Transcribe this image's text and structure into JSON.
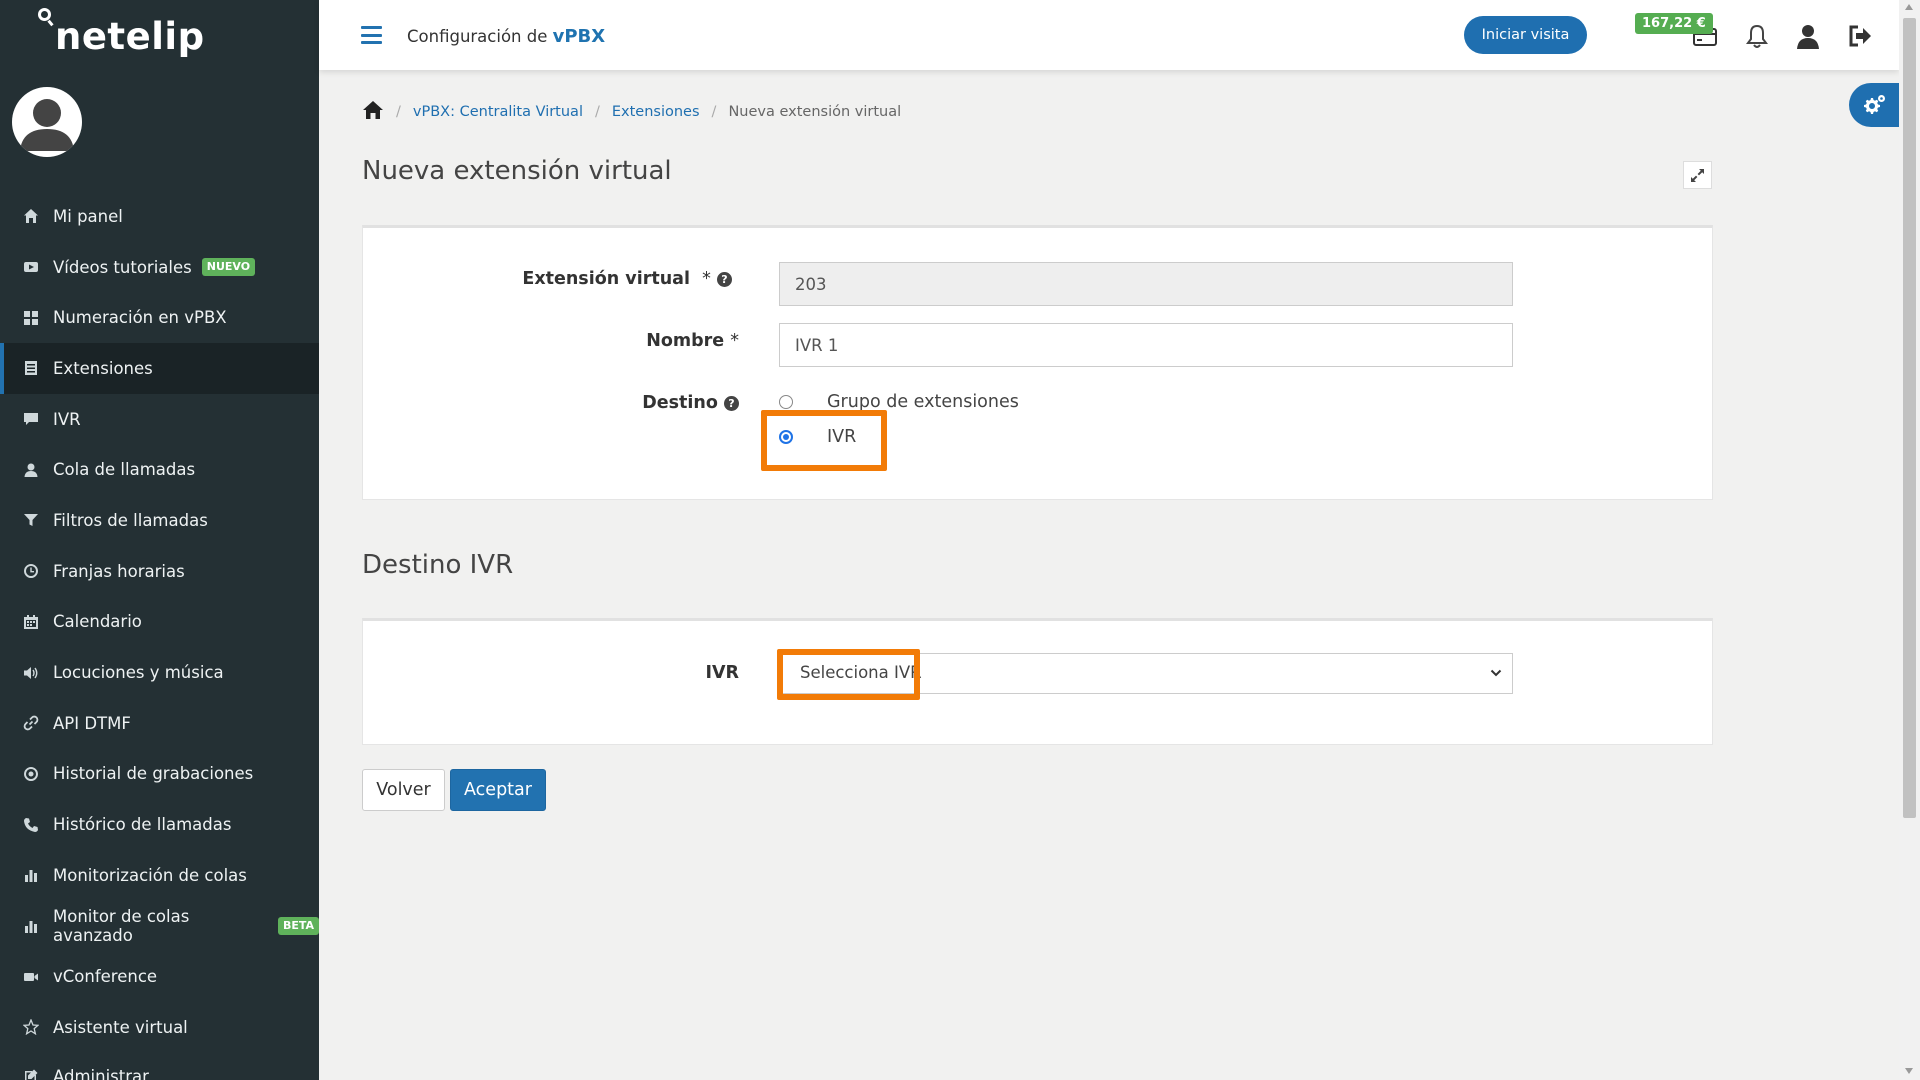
{
  "app": {
    "logo_text": "netelip"
  },
  "sidebar": {
    "items": [
      {
        "label": "Mi panel",
        "icon": "home-icon"
      },
      {
        "label": "Vídeos tutoriales",
        "icon": "video-icon",
        "badge": "NUEVO"
      },
      {
        "label": "Numeración en vPBX",
        "icon": "grid-icon"
      },
      {
        "label": "Extensiones",
        "icon": "list-icon",
        "active": true
      },
      {
        "label": "IVR",
        "icon": "comment-icon"
      },
      {
        "label": "Cola de llamadas",
        "icon": "user-icon"
      },
      {
        "label": "Filtros de llamadas",
        "icon": "filter-icon"
      },
      {
        "label": "Franjas horarias",
        "icon": "clock-icon"
      },
      {
        "label": "Calendario",
        "icon": "calendar-icon"
      },
      {
        "label": "Locuciones y música",
        "icon": "volume-icon"
      },
      {
        "label": "API DTMF",
        "icon": "link-icon"
      },
      {
        "label": "Historial de grabaciones",
        "icon": "record-icon"
      },
      {
        "label": "Histórico de llamadas",
        "icon": "phone-icon"
      },
      {
        "label": "Monitorización de colas",
        "icon": "bar-chart-icon"
      },
      {
        "label": "Monitor de colas avanzado",
        "icon": "bar-chart-icon",
        "badge": "BETA"
      },
      {
        "label": "vConference",
        "icon": "video-camera-icon"
      },
      {
        "label": "Asistente virtual",
        "icon": "star-icon"
      },
      {
        "label": "Administrar",
        "icon": "edit-icon"
      }
    ]
  },
  "header": {
    "title_prefix": "Configuración de ",
    "title_brand": "vPBX",
    "visit_button": "Iniciar visita",
    "balance": "167,22 €"
  },
  "breadcrumb": {
    "items": [
      "vPBX: Centralita Virtual",
      "Extensiones"
    ],
    "current": "Nueva extensión virtual"
  },
  "page": {
    "title": "Nueva extensión virtual",
    "form": {
      "extension_label": "Extensión virtual",
      "extension_value": "203",
      "name_label": "Nombre",
      "name_value": "IVR 1",
      "destination_label": "Destino",
      "destination_options": [
        "Grupo de extensiones",
        "IVR"
      ],
      "destination_selected": "IVR",
      "required_mark": "*",
      "help_mark": "?"
    },
    "ivr_section": {
      "title": "Destino IVR",
      "ivr_label": "IVR",
      "ivr_selected": "Selecciona IVR"
    },
    "buttons": {
      "back": "Volver",
      "accept": "Aceptar"
    }
  },
  "colors": {
    "sidebar_bg": "#243034",
    "accent": "#1f6fb0",
    "highlight": "#f27b07",
    "badge_green": "#5fb25b"
  }
}
